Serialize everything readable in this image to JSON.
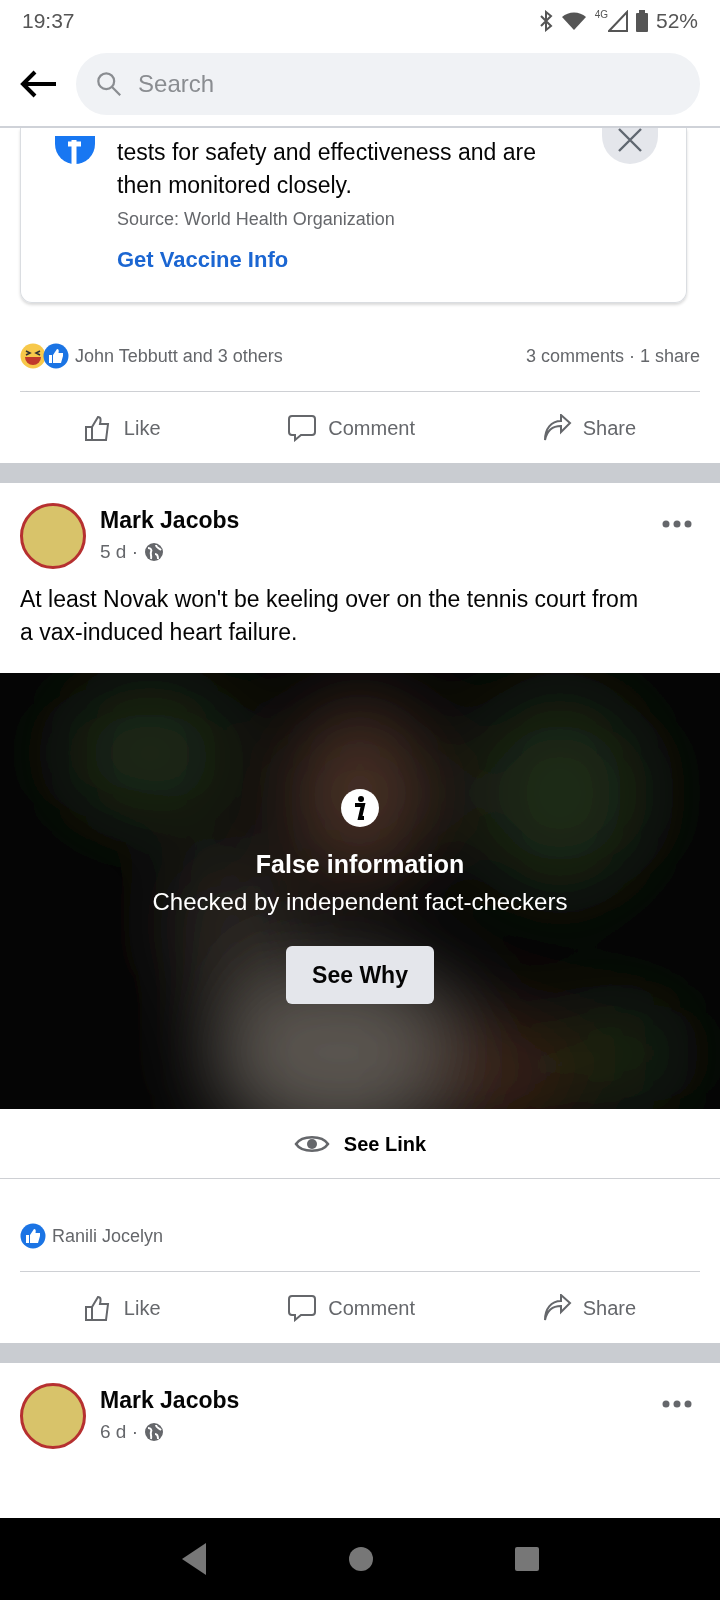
{
  "status_bar": {
    "time": "19:37",
    "network": "4G",
    "battery": "52%"
  },
  "search": {
    "placeholder": "Search"
  },
  "info_card": {
    "text": "tests for safety and effectiveness and are then monitored closely.",
    "source": "Source: World Health Organization",
    "link": "Get Vaccine Info"
  },
  "posts": [
    {
      "reactions": {
        "kinds": [
          {
            "kind": "haha"
          },
          {
            "kind": "like"
          }
        ],
        "names": "John Tebbutt and 3 others",
        "counts": "3 comments · 1 share"
      },
      "actions": [
        "Like",
        "Comment",
        "Share"
      ]
    },
    {
      "author": "Mark Jacobs",
      "time": "5 d ·",
      "text": "At least Novak won't be keeling over on the tennis court from a vax-induced heart failure.",
      "overlay": {
        "kind": "picture",
        "title": "False information",
        "subtitle": "Checked by independent fact-checkers",
        "button": "See Why",
        "link": "See Link"
      },
      "reactions": {
        "kinds": [
          {
            "kind": "like"
          }
        ],
        "names": "Ranili Jocelyn"
      },
      "actions": [
        "Like",
        "Comment",
        "Share"
      ]
    },
    {
      "author": "Mark Jacobs",
      "time": "6 d ·"
    }
  ]
}
